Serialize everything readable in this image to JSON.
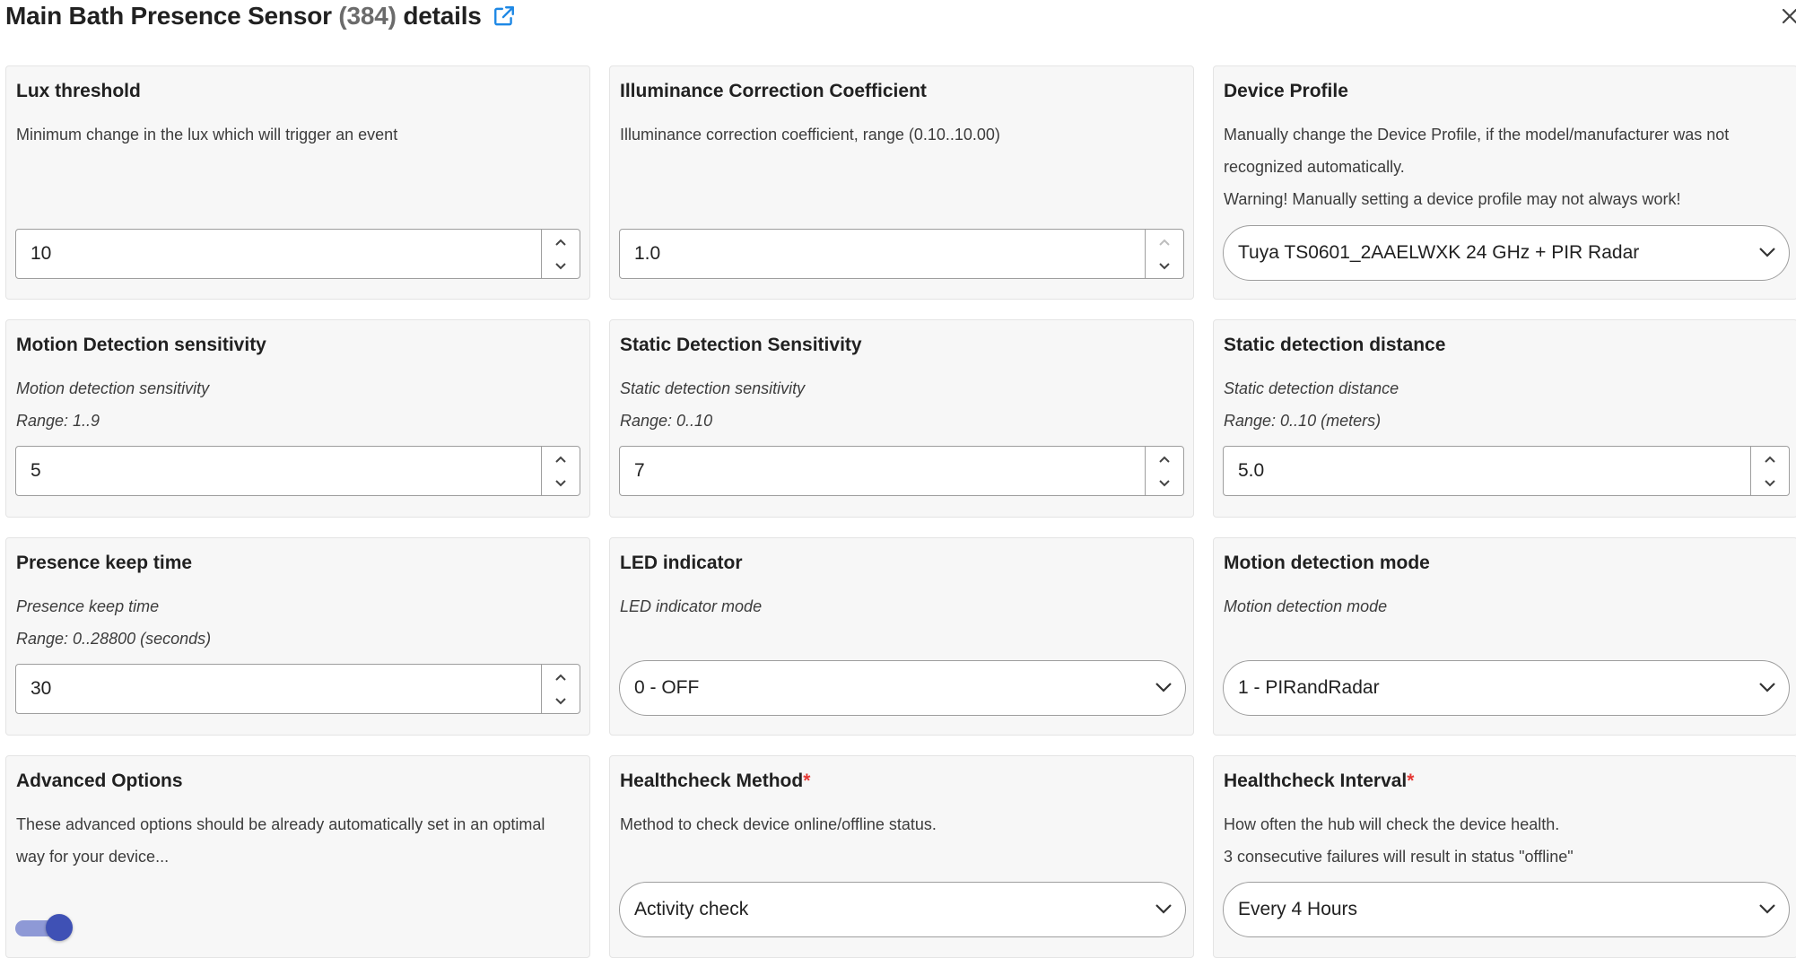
{
  "header": {
    "title": "Main Bath Presence Sensor",
    "device_id": "(384)",
    "title_suffix": "details"
  },
  "colors": {
    "accent": "#3f51b5",
    "toggle_track": "#8e99d6",
    "required": "#e53935",
    "link": "#1e88e5"
  },
  "cards": {
    "lux_threshold": {
      "title": "Lux threshold",
      "description": "Minimum change in the lux which will trigger an event",
      "value": "10"
    },
    "illuminance_correction": {
      "title": "Illuminance Correction Coefficient",
      "description": "Illuminance correction coefficient, range (0.10..10.00)",
      "value": "1.0"
    },
    "device_profile": {
      "title": "Device Profile",
      "description": "Manually change the Device Profile, if the model/manufacturer was not recognized automatically.",
      "warning": "Warning! Manually setting a device profile may not always work!",
      "selected": "Tuya TS0601_2AAELWXK 24 GHz + PIR Radar"
    },
    "motion_sensitivity": {
      "title": "Motion Detection sensitivity",
      "description": "Motion detection sensitivity",
      "range": "Range: 1..9",
      "value": "5"
    },
    "static_sensitivity": {
      "title": "Static Detection Sensitivity",
      "description": "Static detection sensitivity",
      "range": "Range: 0..10",
      "value": "7"
    },
    "static_distance": {
      "title": "Static detection distance",
      "description": "Static detection distance",
      "range": "Range: 0..10 (meters)",
      "value": "5.0"
    },
    "presence_keep_time": {
      "title": "Presence keep time",
      "description": "Presence keep time",
      "range": "Range: 0..28800 (seconds)",
      "value": "30"
    },
    "led_indicator": {
      "title": "LED indicator",
      "description": "LED indicator mode",
      "selected": "0 - OFF"
    },
    "motion_mode": {
      "title": "Motion detection mode",
      "description": "Motion detection mode",
      "selected": "1 - PIRandRadar"
    },
    "advanced_options": {
      "title": "Advanced Options",
      "description": "These advanced options should be already automatically set in an optimal way for your device...",
      "enabled": true
    },
    "healthcheck_method": {
      "title": "Healthcheck Method",
      "required_mark": "*",
      "description": "Method to check device online/offline status.",
      "selected": "Activity check"
    },
    "healthcheck_interval": {
      "title": "Healthcheck Interval",
      "required_mark": "*",
      "description": "How often the hub will check the device health.",
      "description2": "3 consecutive failures will result in status \"offline\"",
      "selected": "Every 4 Hours"
    }
  }
}
